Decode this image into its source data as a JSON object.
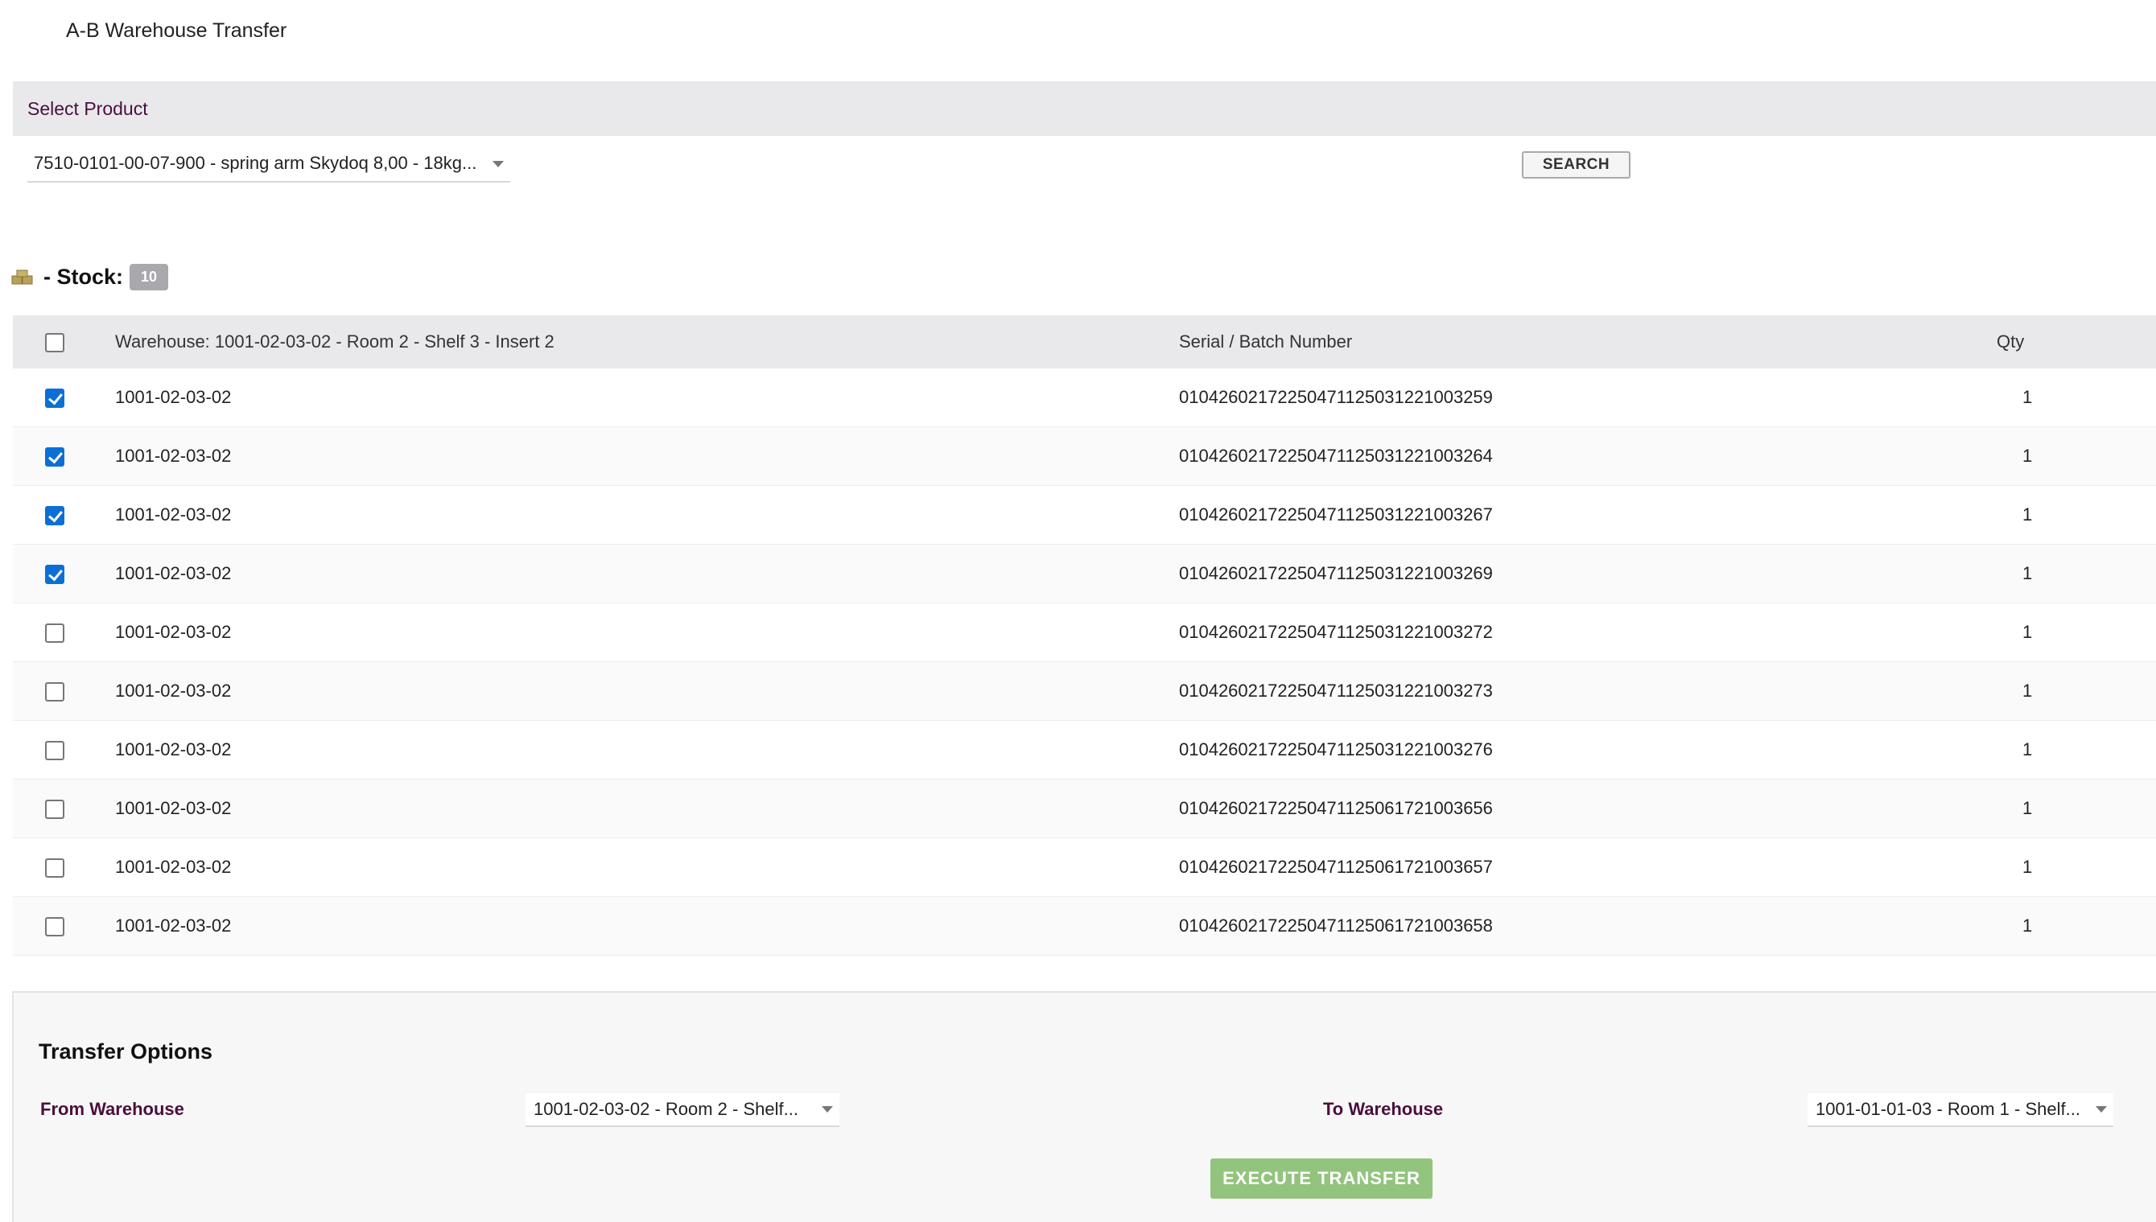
{
  "page": {
    "title": "A-B Warehouse Transfer"
  },
  "product": {
    "section_label": "Select Product",
    "selected": "7510-0101-00-07-900 - spring arm Skydoq 8,00 - 18kg...",
    "search_label": "SEARCH"
  },
  "stock": {
    "label": "- Stock:",
    "count": "10",
    "icon": "boxes-icon",
    "columns": {
      "warehouse": "Warehouse: 1001-02-03-02 - Room 2 - Shelf 3 - Insert 2",
      "serial": "Serial / Batch Number",
      "qty": "Qty"
    },
    "rows": [
      {
        "checked": true,
        "warehouse": "1001-02-03-02",
        "serial": "010426021722504711250312210032​59",
        "qty": "1"
      },
      {
        "checked": true,
        "warehouse": "1001-02-03-02",
        "serial": "0104260217225047112503122100 3264",
        "qty": "1"
      },
      {
        "checked": true,
        "warehouse": "1001-02-03-02",
        "serial": "01042602172250471125031221003267",
        "qty": "1"
      },
      {
        "checked": true,
        "warehouse": "1001-02-03-02",
        "serial": "01042602172250471125031221003269",
        "qty": "1"
      },
      {
        "checked": false,
        "warehouse": "1001-02-03-02",
        "serial": "01042602172250471125031221003272",
        "qty": "1"
      },
      {
        "checked": false,
        "warehouse": "1001-02-03-02",
        "serial": "01042602172250471125031221003273",
        "qty": "1"
      },
      {
        "checked": false,
        "warehouse": "1001-02-03-02",
        "serial": "01042602172250471125031221003276",
        "qty": "1"
      },
      {
        "checked": false,
        "warehouse": "1001-02-03-02",
        "serial": "01042602172250471125061721003656",
        "qty": "1"
      },
      {
        "checked": false,
        "warehouse": "1001-02-03-02",
        "serial": "01042602172250471125061721003657",
        "qty": "1"
      },
      {
        "checked": false,
        "warehouse": "1001-02-03-02",
        "serial": "01042602172250471125061721003658",
        "qty": "1"
      }
    ]
  },
  "transfer": {
    "title": "Transfer Options",
    "from_label": "From Warehouse",
    "from_value": "1001-02-03-02 - Room 2 - Shelf...",
    "to_label": "To Warehouse",
    "to_value": "1001-01-01-03 - Room 1 - Shelf...",
    "execute_label": "EXECUTE TRANSFER"
  },
  "colors": {
    "accent_label": "#4a0f3c",
    "checkbox_checked": "#0b6fd6",
    "execute_button": "#92c47d",
    "header_band": "#e9e9ec"
  }
}
